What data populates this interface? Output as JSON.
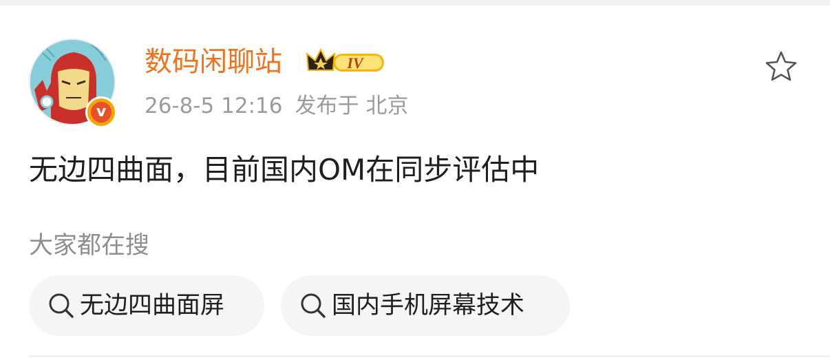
{
  "post": {
    "username": "数码闲聊站",
    "level_badge_text": "IV",
    "timestamp": "26-8-5 12:16",
    "published_prefix": "发布于",
    "location": "北京",
    "verified_mark": "v",
    "content": "无边四曲面，目前国内OM在同步评估中"
  },
  "search_section": {
    "heading": "大家都在搜",
    "chips": [
      {
        "label": "无边四曲面屏"
      },
      {
        "label": "国内手机屏幕技术"
      }
    ]
  },
  "icons": {
    "favorite": "star-outline-icon",
    "search": "search-icon",
    "level": "crown-icon"
  },
  "colors": {
    "username": "#f0721e",
    "badge_gold": "#f7b500",
    "verified_orange": "#e8502a",
    "meta_gray": "#9b9b9b",
    "chip_bg": "#f5f5f5"
  }
}
